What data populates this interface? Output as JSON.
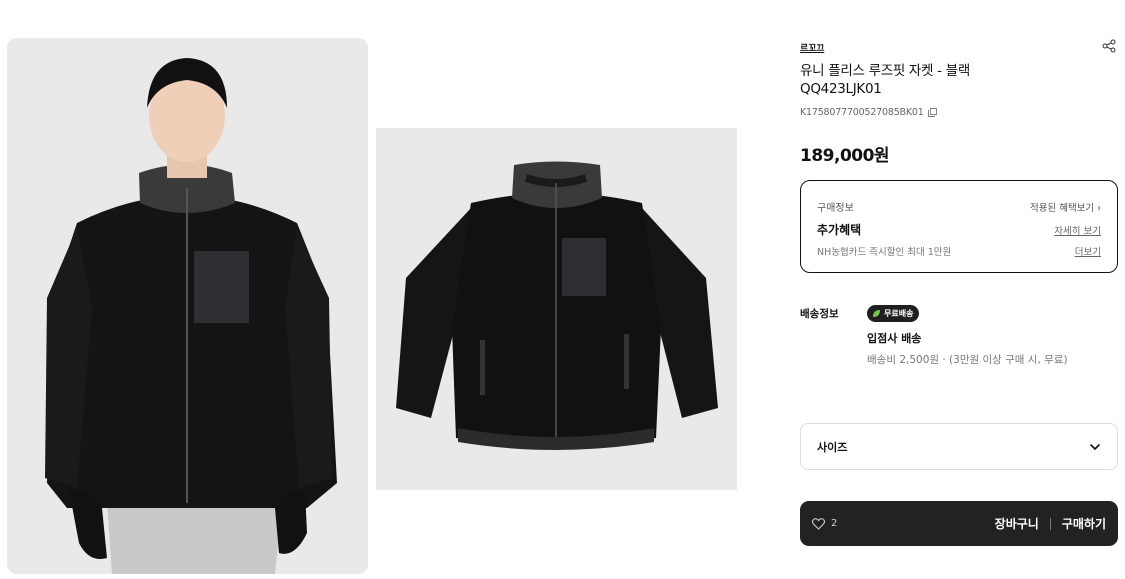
{
  "gallery": {
    "main_image_alt": "모델 착용 이미지",
    "second_image_alt": "제품 이미지"
  },
  "product": {
    "brand": "르꼬끄",
    "title_line1": "유니 플리스 루즈핏 자켓 - 블랙",
    "title_line2": "QQ423LJK01",
    "sku": "K1758077700527085BK01",
    "price": "189,000원"
  },
  "benefits": {
    "label": "구매정보",
    "applied_link": "적용된 혜택보기 ›",
    "heading": "추가혜택",
    "detail_link": "자세히 보기",
    "description": "NH농협카드 즉시할인 최대 1만원",
    "more_link": "더보기"
  },
  "shipping": {
    "label": "배송정보",
    "badge": "무료배송",
    "method": "입점사 배송",
    "cost": "배송비 2,500원 · (3만원 이상 구매 시, 무료)"
  },
  "size": {
    "label": "사이즈"
  },
  "actions": {
    "like_count": "2",
    "cart": "장바구니",
    "buy": "구매하기"
  },
  "colors": {
    "accent_dark": "#222222",
    "badge_leaf": "#7ac943",
    "image_bg": "#e9e9e9"
  }
}
